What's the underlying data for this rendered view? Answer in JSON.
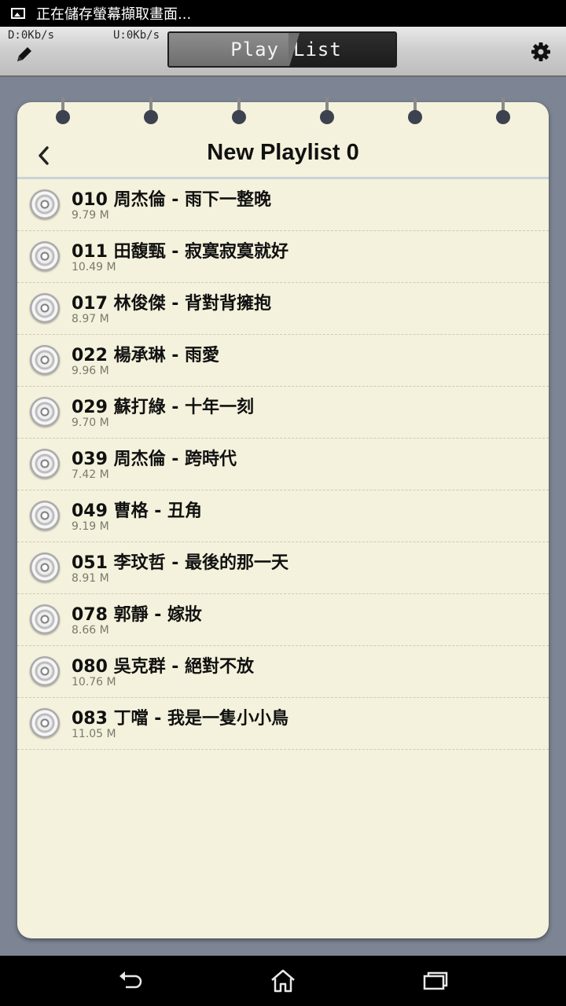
{
  "status_bar": {
    "notification_text": "正在儲存螢幕擷取畫面..."
  },
  "toolbar": {
    "download_speed": "D:0Kb/s",
    "upload_speed": "U:0Kb/s",
    "mode_play_label": "Play",
    "mode_list_label": "List",
    "active_mode": "List"
  },
  "playlist": {
    "title": "New Playlist 0",
    "songs": [
      {
        "title": "010 周杰倫 - 雨下一整晚",
        "size": "9.79 M"
      },
      {
        "title": "011 田馥甄 - 寂寞寂寞就好",
        "size": "10.49 M"
      },
      {
        "title": "017 林俊傑 - 背對背擁抱",
        "size": "8.97 M"
      },
      {
        "title": "022 楊承琳 - 雨愛",
        "size": "9.96 M"
      },
      {
        "title": "029 蘇打綠 - 十年一刻",
        "size": "9.70 M"
      },
      {
        "title": "039 周杰倫 - 跨時代",
        "size": "7.42 M"
      },
      {
        "title": "049 曹格 - 丑角",
        "size": "9.19 M"
      },
      {
        "title": "051 李玟哲 - 最後的那一天",
        "size": "8.91 M"
      },
      {
        "title": "078 郭靜 - 嫁妝",
        "size": "8.66 M"
      },
      {
        "title": "080 吳克群 - 絕對不放",
        "size": "10.76 M"
      },
      {
        "title": "083 丁噹 - 我是一隻小小鳥",
        "size": "11.05 M"
      }
    ]
  },
  "icons": {
    "status": "image-icon",
    "edit": "pencil-icon",
    "settings": "gear-icon",
    "back": "chevron-left-icon",
    "song": "cd-disc-icon",
    "nav": [
      "back-arrow-icon",
      "home-icon",
      "recent-apps-icon"
    ]
  },
  "colors": {
    "card_background": "#f4f2dc",
    "page_background": "#7d8594",
    "active_tab": "#1c1c1c"
  }
}
